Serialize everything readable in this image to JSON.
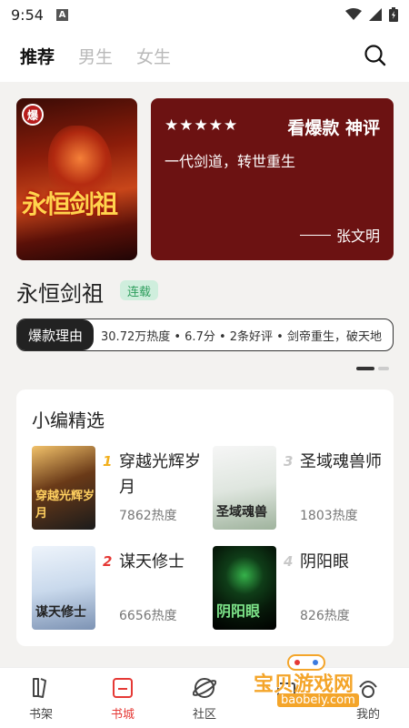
{
  "status_bar": {
    "time": "9:54",
    "notification_letter": "A"
  },
  "top_nav": {
    "tabs": [
      "推荐",
      "男生",
      "女生"
    ],
    "active_index": 0
  },
  "banner": {
    "cover_badge": "爆",
    "cover_title": "永恒剑祖",
    "stars": "★★★★★",
    "headline": "看爆款 神评",
    "quote": "一代剑道，转世重生",
    "author": "张文明",
    "book_title": "永恒剑祖",
    "status_tag": "连载",
    "reason_label": "爆款理由",
    "reason_text": "30.72万热度 • 6.7分 • 2条好评 • 剑帝重生，破天地",
    "page_count": 2,
    "active_page": 0
  },
  "picks": {
    "title": "小编精选",
    "items": [
      {
        "rank": "1",
        "name": "穿越光辉岁月",
        "heat": "7862热度",
        "cover_text": "穿越光辉岁月",
        "rank_color": "#f2b01e"
      },
      {
        "rank": "3",
        "name": "圣域魂兽师",
        "heat": "1803热度",
        "cover_text": "圣域魂兽",
        "rank_color": "#c8c8c8"
      },
      {
        "rank": "2",
        "name": "谋天修士",
        "heat": "6656热度",
        "cover_text": "谋天修士",
        "rank_color": "#e53935"
      },
      {
        "rank": "4",
        "name": "阴阳眼",
        "heat": "826热度",
        "cover_text": "阴阳眼",
        "rank_color": "#c8c8c8"
      }
    ]
  },
  "tab_bar": {
    "items": [
      {
        "label": "书架",
        "icon": "bookshelf-icon"
      },
      {
        "label": "书城",
        "icon": "bookstore-icon"
      },
      {
        "label": "社区",
        "icon": "community-icon"
      },
      {
        "label": "",
        "icon": "welfare-icon"
      },
      {
        "label": "我的",
        "icon": "profile-icon"
      }
    ],
    "active_index": 1
  },
  "watermark": {
    "main": "宝贝游戏网",
    "sub": "baobeiy.com"
  },
  "colors": {
    "accent": "#e53935",
    "banner_bg": "#6c1212",
    "tag_green": "#2e9e5d"
  }
}
